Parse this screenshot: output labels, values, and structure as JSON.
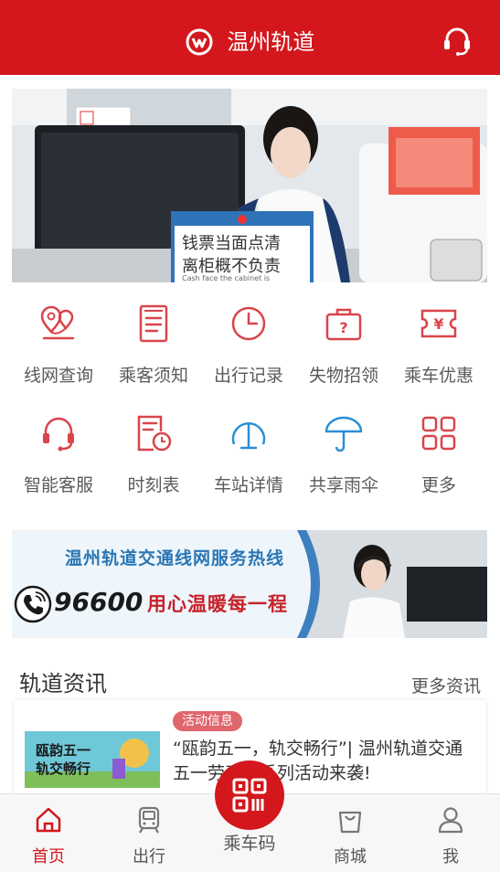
{
  "header": {
    "title": "温州轨道"
  },
  "banner": {
    "sign_line1": "钱票当面点清",
    "sign_line2": "离柜概不负责",
    "sign_line3": "Cash face the cabinet is"
  },
  "grid": [
    {
      "label": "线网查询",
      "icon": "map-pin-icon"
    },
    {
      "label": "乘客须知",
      "icon": "document-icon"
    },
    {
      "label": "出行记录",
      "icon": "clock-icon"
    },
    {
      "label": "失物招领",
      "icon": "lost-found-bag-icon"
    },
    {
      "label": "乘车优惠",
      "icon": "coupon-icon"
    },
    {
      "label": "智能客服",
      "icon": "headset-icon"
    },
    {
      "label": "时刻表",
      "icon": "timetable-icon"
    },
    {
      "label": "车站详情",
      "icon": "station-icon"
    },
    {
      "label": "共享雨伞",
      "icon": "umbrella-icon"
    },
    {
      "label": "更多",
      "icon": "grid-icon"
    }
  ],
  "hotline": {
    "title": "温州轨道交通线网服务热线",
    "number": "96600",
    "slogan": "用心温暖每一程"
  },
  "news": {
    "section_title": "轨道资讯",
    "more": "更多资讯",
    "items": [
      {
        "tag": "活动信息",
        "title": "“瓯韵五一，轨交畅行”| 温州轨道交通五一劳动节系列活动来袭!",
        "thumb_line1": "瓯韵五一",
        "thumb_line2": "轨交畅行"
      }
    ]
  },
  "tabbar": [
    {
      "label": "首页",
      "icon": "home-icon",
      "active": true
    },
    {
      "label": "出行",
      "icon": "train-icon",
      "active": false
    },
    {
      "label": "乘车码",
      "icon": "qr-code-icon",
      "active": false
    },
    {
      "label": "商城",
      "icon": "shopping-bag-icon",
      "active": false
    },
    {
      "label": "我",
      "icon": "user-icon",
      "active": false
    }
  ],
  "colors": {
    "brand_red": "#d3171c",
    "icon_red": "#d9444a",
    "icon_blue": "#2a8fd6"
  }
}
